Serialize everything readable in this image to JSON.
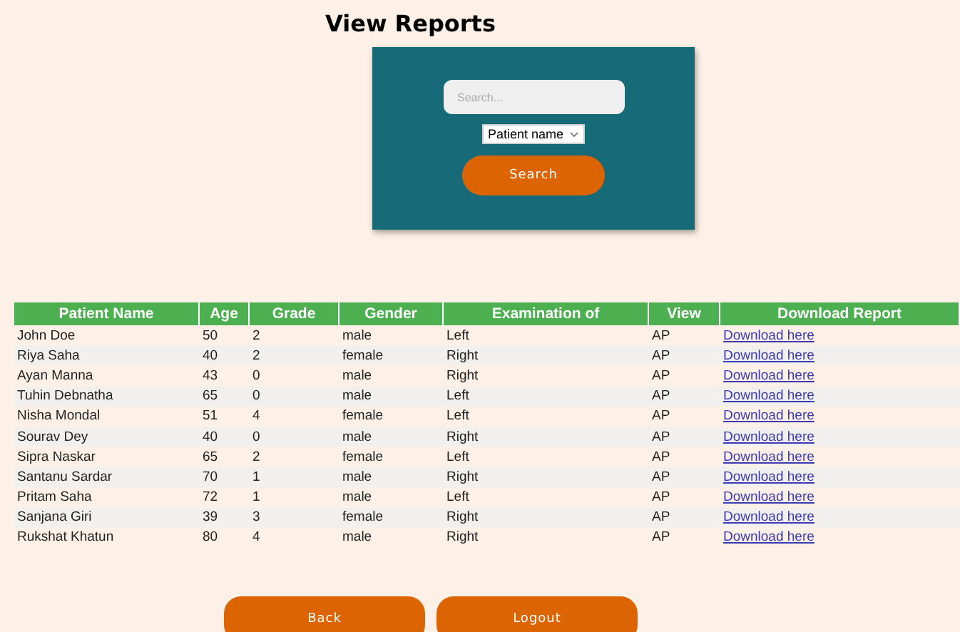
{
  "title": "View Reports",
  "search": {
    "placeholder": "Search...",
    "filter": "Patient name",
    "button": "Search"
  },
  "table": {
    "columns": [
      "Patient Name",
      "Age",
      "Grade",
      "Gender",
      "Examination of",
      "View",
      "Download Report"
    ],
    "rows": [
      [
        "John Doe",
        "50",
        "2",
        "male",
        "Left",
        "AP",
        "Download here"
      ],
      [
        "Riya Saha",
        "40",
        "2",
        "female",
        "Right",
        "AP",
        "Download here"
      ],
      [
        "Ayan Manna",
        "43",
        "0",
        "male",
        "Right",
        "AP",
        "Download here"
      ],
      [
        "Tuhin Debnatha",
        "65",
        "0",
        "male",
        "Left",
        "AP",
        "Download here"
      ],
      [
        "Nisha Mondal",
        "51",
        "4",
        "female",
        "Left",
        "AP",
        "Download here"
      ],
      [
        "Sourav Dey",
        "40",
        "0",
        "male",
        "Right",
        "AP",
        "Download here"
      ],
      [
        "Sipra Naskar",
        "65",
        "2",
        "female",
        "Left",
        "AP",
        "Download here"
      ],
      [
        "Santanu Sardar",
        "70",
        "1",
        "male",
        "Right",
        "AP",
        "Download here"
      ],
      [
        "Pritam Saha",
        "72",
        "1",
        "male",
        "Left",
        "AP",
        "Download here"
      ],
      [
        "Sanjana Giri",
        "39",
        "3",
        "female",
        "Right",
        "AP",
        "Download here"
      ],
      [
        "Rukshat Khatun",
        "80",
        "4",
        "male",
        "Right",
        "AP",
        "Download here"
      ]
    ]
  },
  "buttons": [
    "Back",
    "Logout"
  ]
}
